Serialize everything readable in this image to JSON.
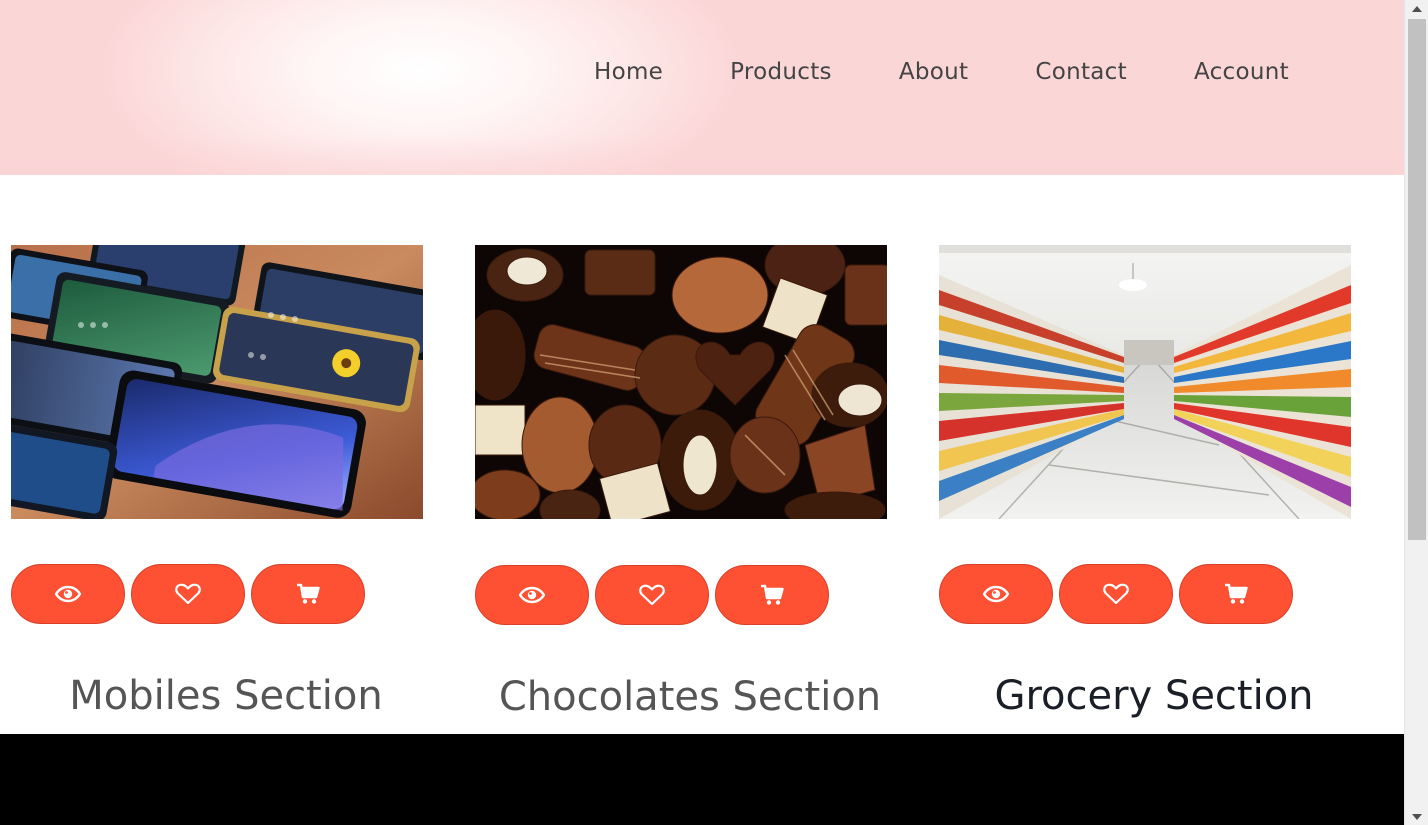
{
  "nav": {
    "items": [
      {
        "label": "Home"
      },
      {
        "label": "Products"
      },
      {
        "label": "About"
      },
      {
        "label": "Contact"
      },
      {
        "label": "Account"
      }
    ]
  },
  "sections": [
    {
      "title": "Mobiles Section",
      "image": "mobile-phones-photo",
      "actions": [
        "eye-icon",
        "heart-icon",
        "cart-icon"
      ]
    },
    {
      "title": "Chocolates Section",
      "image": "chocolates-photo",
      "actions": [
        "eye-icon",
        "heart-icon",
        "cart-icon"
      ]
    },
    {
      "title": "Grocery Section",
      "image": "grocery-aisle-photo",
      "actions": [
        "eye-icon",
        "heart-icon",
        "cart-icon"
      ]
    }
  ],
  "colors": {
    "accent": "#fe5033",
    "header_tint": "#fbd6d7",
    "footer": "#000000"
  }
}
